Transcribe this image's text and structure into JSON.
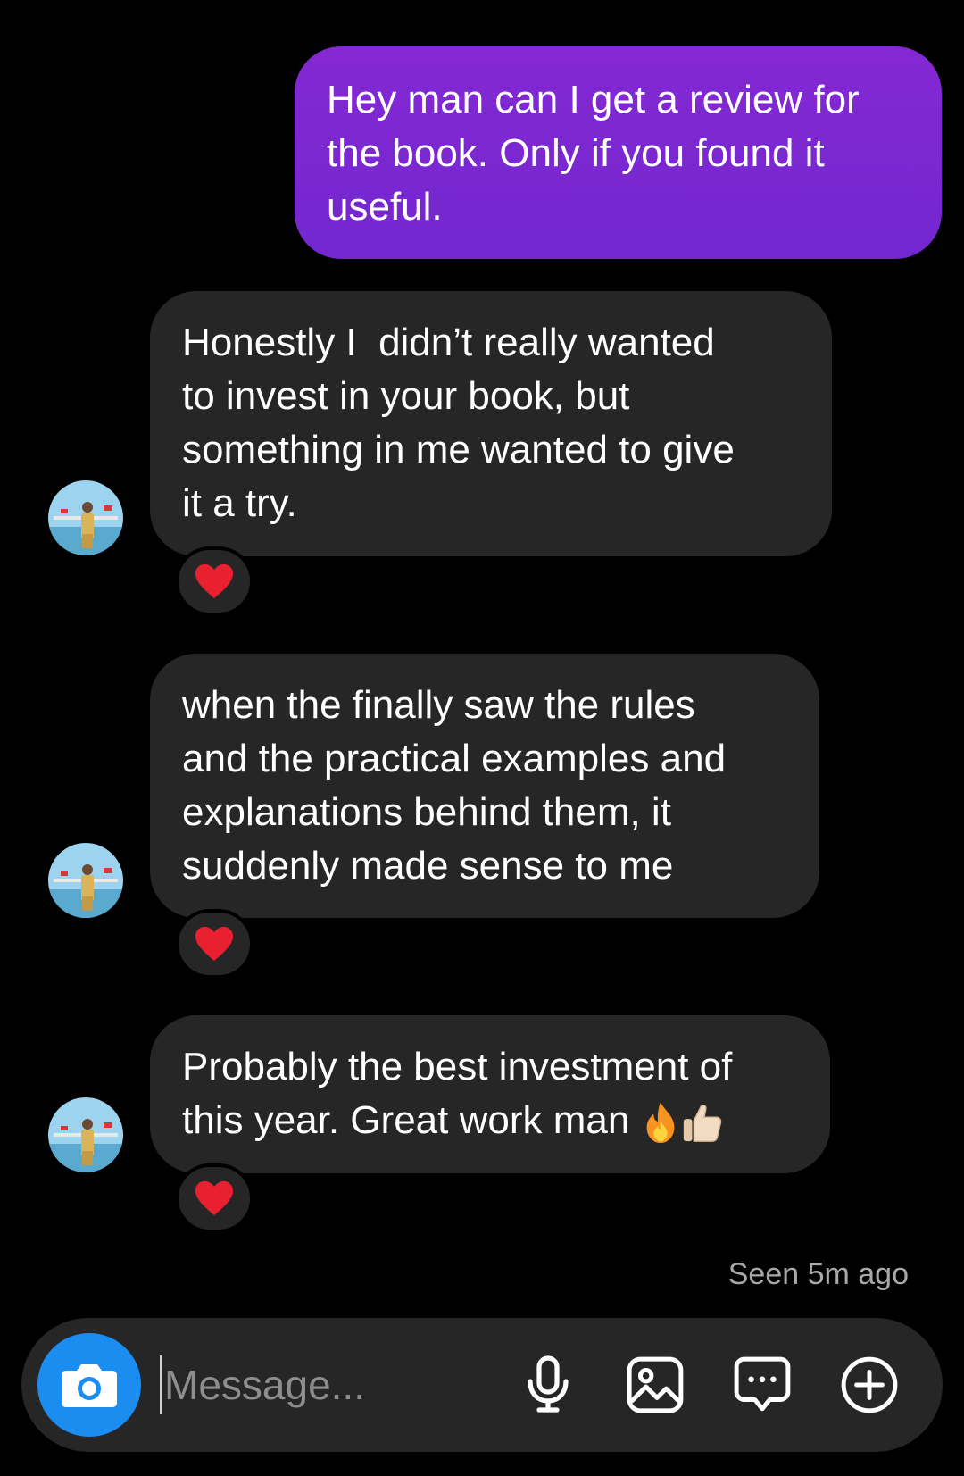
{
  "messages": {
    "outgoing_1": "Hey man can I get a review for\nthe book. Only if you found it\nuseful.",
    "incoming_1": "Honestly I  didn’t really wanted\nto invest in your book, but\nsomething in me wanted to give\nit a try.",
    "incoming_2": "when the finally saw the rules\nand the practical examples and\nexplanations behind them, it\nsuddenly made sense to me",
    "incoming_3": "Probably the best investment of\nthis year. Great work man ",
    "incoming_3_emoji": [
      "fire-emoji",
      "thumbs-up-emoji"
    ]
  },
  "reactions": [
    "heart",
    "heart",
    "heart"
  ],
  "status": {
    "seen": "Seen 5m ago"
  },
  "composer": {
    "placeholder": "Message...",
    "value": ""
  },
  "colors": {
    "background": "#000000",
    "incoming_bubble": "#262626",
    "outgoing_bubble": "#7f27d1",
    "camera_button": "#1b8cf0",
    "seen_text": "#a8a8a8"
  },
  "icons": [
    "camera-icon",
    "microphone-icon",
    "gallery-icon",
    "sticker-icon",
    "plus-icon"
  ]
}
